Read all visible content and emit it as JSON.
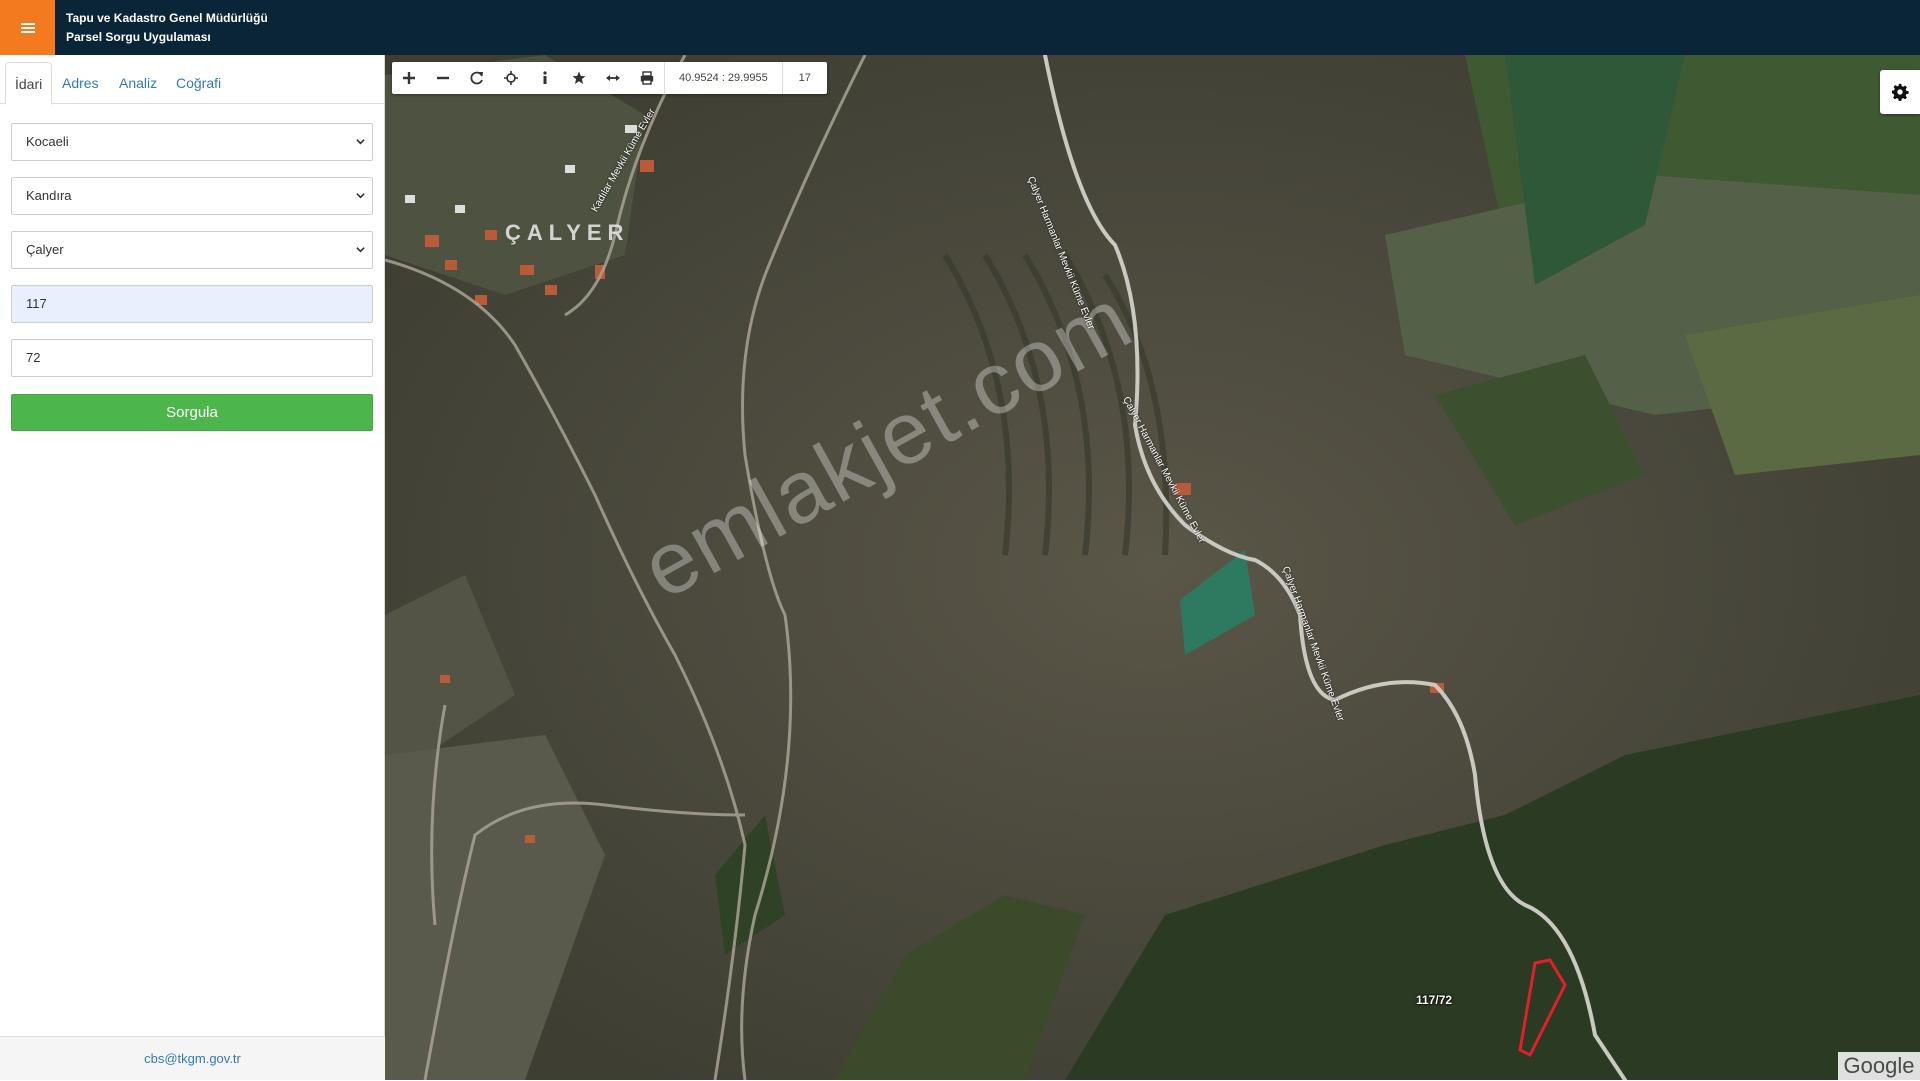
{
  "header": {
    "org_name": "Tapu ve Kadastro Genel Müdürlüğü",
    "app_name": "Parsel Sorgu Uygulaması",
    "menu_icon": "hamburger-icon"
  },
  "sidebar": {
    "tabs": [
      {
        "label": "İdari",
        "active": true
      },
      {
        "label": "Adres",
        "active": false
      },
      {
        "label": "Analiz",
        "active": false
      },
      {
        "label": "Coğrafi",
        "active": false
      }
    ],
    "form": {
      "province": "Kocaeli",
      "district": "Kandıra",
      "neighborhood": "Çalyer",
      "block": "117",
      "parcel": "72",
      "submit_label": "Sorgula"
    },
    "footer_email": "cbs@tkgm.gov.tr"
  },
  "toolbar": {
    "icons": [
      "zoom-in-icon",
      "zoom-out-icon",
      "refresh-icon",
      "locate-icon",
      "info-icon",
      "favorite-icon",
      "measure-icon",
      "print-icon"
    ],
    "coordinates": "40.9524 : 29.9955",
    "zoom_level": "17"
  },
  "map": {
    "village_label": "ÇALYER",
    "watermark": "emlakjet.com",
    "parcel_label": "117/72",
    "road_labels": [
      "Kadılar Mevkii Küme Evler",
      "Çalyer Harmanlar Mevkii Küme Evler",
      "Çalyer Harmanlar Mevkii Küme Evler",
      "Çalyer Harmanlar Mevkii Küme Evler"
    ],
    "attribution": "Google",
    "parcel_color": "#e0202a"
  }
}
